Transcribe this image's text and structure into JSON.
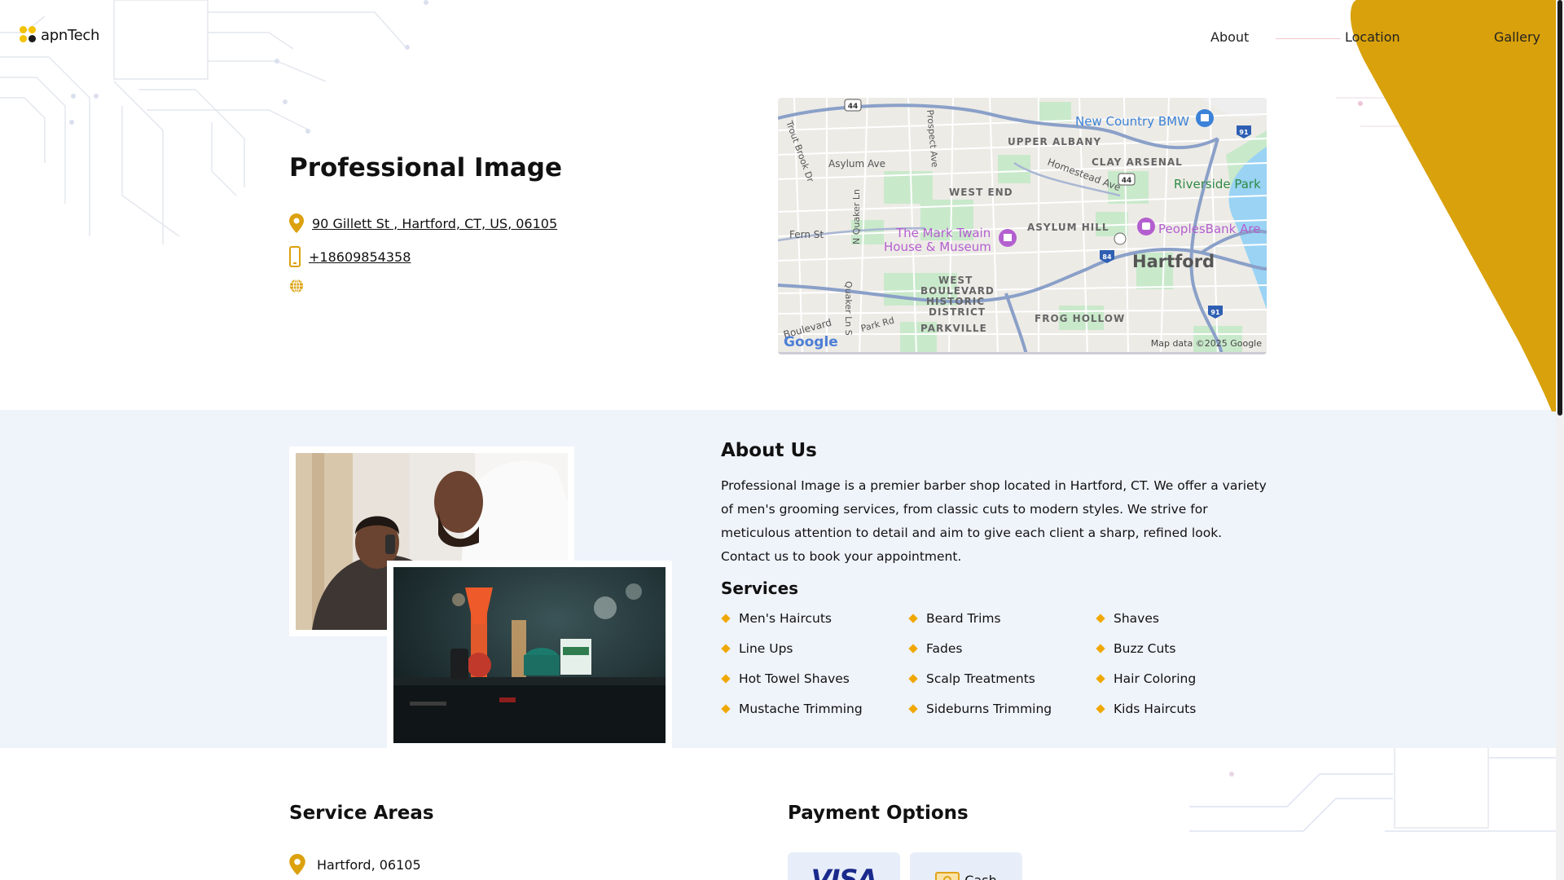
{
  "header": {
    "logo_text": "apnTech",
    "nav": [
      "About",
      "Location",
      "Gallery"
    ]
  },
  "business": {
    "name": "Professional Image",
    "address": "90 Gillett St , Hartford, CT, US, 06105",
    "phone": "+18609854358"
  },
  "map": {
    "labels": {
      "road44a": "44",
      "road44b": "44",
      "road84": "84",
      "road91a": "91",
      "road91b": "91",
      "trout": "Trout Brook Dr",
      "prospect": "Prospect Ave",
      "asylum": "Asylum Ave",
      "bmw": "New Country BMW",
      "upper_albany": "UPPER ALBANY",
      "clay_arsenal": "CLAY ARSENAL",
      "homestead": "Homestead Ave",
      "riverside": "Riverside Park",
      "west_end": "WEST END",
      "quaker_n": "N Quaker Ln",
      "fern": "Fern St",
      "twain1": "The Mark Twain",
      "twain2": "House & Museum",
      "asylum_hill": "ASYLUM HILL",
      "peoples": "PeoplesBank Are",
      "hartford": "Hartford",
      "wb1": "WEST",
      "wb2": "BOULEVARD",
      "wb3": "HISTORIC",
      "wb4": "DISTRICT",
      "quaker_s": "Quaker Ln S",
      "park": "Park Rd",
      "boulevard": "Boulevard",
      "parkville": "PARKVILLE",
      "frog": "FROG HOLLOW",
      "google": "Google",
      "attribution": "Map data ©2025 Google"
    }
  },
  "about": {
    "title": "About Us",
    "text": "Professional Image is a premier barber shop located in Hartford, CT. We offer a variety of men's grooming services, from classic cuts to modern styles. We strive for meticulous attention to detail and aim to give each client a sharp, refined look. Contact us to book your appointment.",
    "services_title": "Services",
    "services": [
      "Men's Haircuts",
      "Beard Trims",
      "Shaves",
      "Line Ups",
      "Fades",
      "Buzz Cuts",
      "Hot Towel Shaves",
      "Scalp Treatments",
      "Hair Coloring",
      "Mustache Trimming",
      "Sideburns Trimming",
      "Kids Haircuts"
    ]
  },
  "service_areas": {
    "title": "Service Areas",
    "items": [
      "Hartford, 06105"
    ]
  },
  "payment": {
    "title": "Payment Options",
    "visa": "VISA",
    "cash": "Cash"
  },
  "icons": {
    "address": "map-pin-icon",
    "phone": "phone-icon",
    "website": "globe-icon"
  },
  "colors": {
    "accent": "#dca10e",
    "logo_yellow": "#f2c200",
    "band": "#eff3fa",
    "visa": "#1a2a8c"
  }
}
